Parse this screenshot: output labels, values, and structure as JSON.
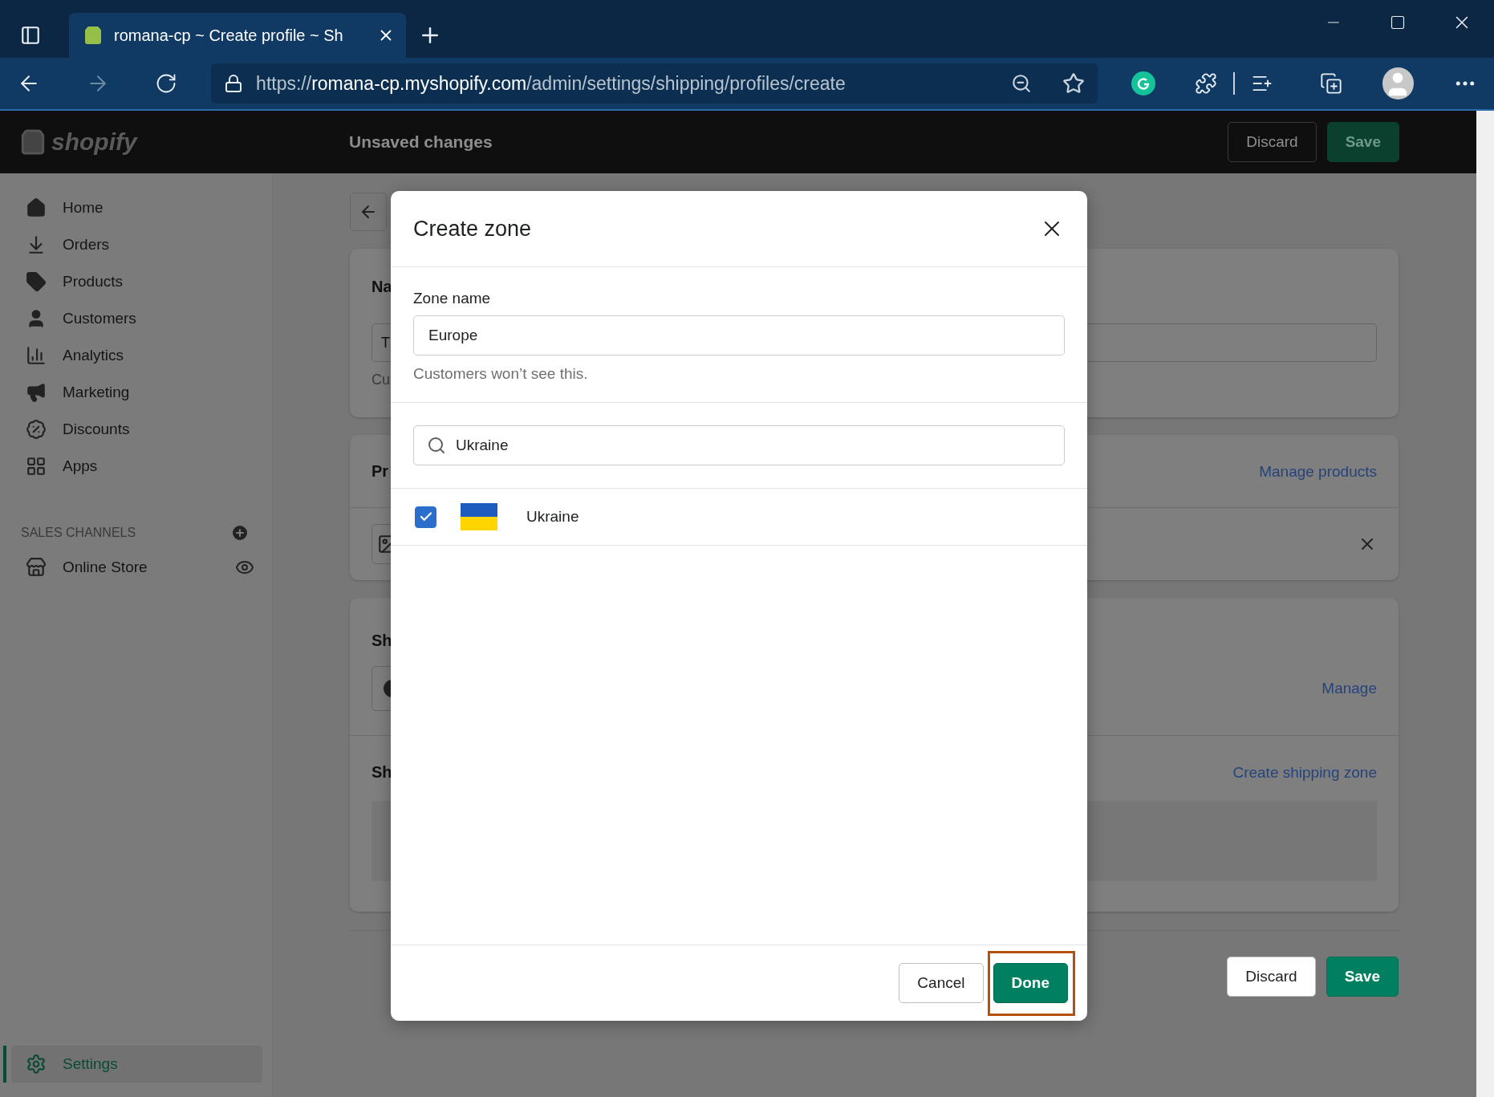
{
  "browser": {
    "tab": {
      "title": "romana-cp ~ Create profile ~ Sh",
      "selected": true
    },
    "url": {
      "scheme": "https://",
      "host": "romana-cp.myshopify.com",
      "path": "/admin/settings/shipping/profiles/create"
    }
  },
  "topbar": {
    "logo": "shopify",
    "title": "Unsaved changes",
    "buttons": [
      {
        "label": "Discard",
        "kind": "secondary"
      },
      {
        "label": "Save",
        "kind": "primary"
      }
    ]
  },
  "sidebar": {
    "items": [
      {
        "label": "Home",
        "selected": false
      },
      {
        "label": "Orders",
        "selected": false
      },
      {
        "label": "Products",
        "selected": false
      },
      {
        "label": "Customers",
        "selected": false
      },
      {
        "label": "Analytics",
        "selected": false
      },
      {
        "label": "Marketing",
        "selected": false
      },
      {
        "label": "Discounts",
        "selected": false
      },
      {
        "label": "Apps",
        "selected": false
      }
    ],
    "sales_channels": {
      "heading": "SALES CHANNELS",
      "items": [
        {
          "label": "Online Store"
        }
      ]
    },
    "settings": {
      "label": "Settings",
      "selected": true
    }
  },
  "page": {
    "card_1": {
      "title": "Na",
      "field_value": "T",
      "help": "Cu"
    },
    "card_2": {
      "title": "Pr",
      "link": "Manage products"
    },
    "card_3": {
      "title": "Sh",
      "link": "Manage",
      "section_title": "Sh",
      "section_link": "Create shipping zone"
    },
    "buttons": [
      {
        "label": "Discard",
        "kind": "secondary"
      },
      {
        "label": "Save",
        "kind": "primary"
      }
    ]
  },
  "modal": {
    "title": "Create zone",
    "zone_name": {
      "label": "Zone name",
      "value": "Europe",
      "help": "Customers won’t see this."
    },
    "search": {
      "value": "Ukraine"
    },
    "results": [
      {
        "name": "Ukraine",
        "checked": true
      }
    ],
    "buttons": [
      {
        "label": "Cancel",
        "kind": "secondary",
        "highlighted": false
      },
      {
        "label": "Done",
        "kind": "primary",
        "highlighted": true
      }
    ]
  }
}
